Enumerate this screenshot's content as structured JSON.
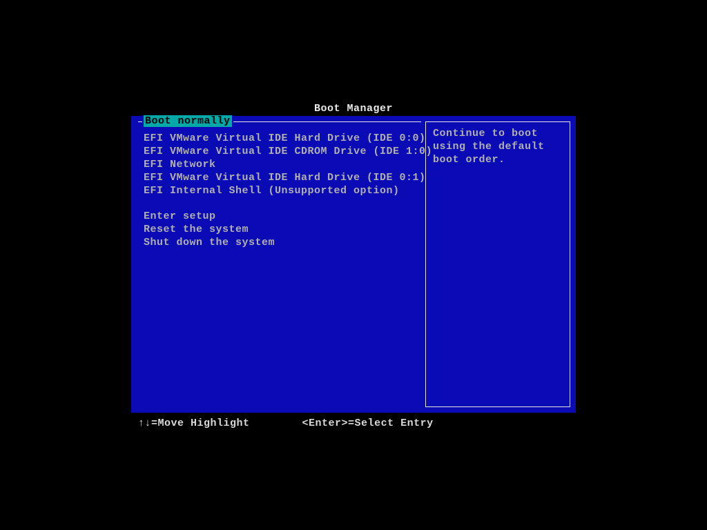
{
  "title": "Boot Manager",
  "menu": {
    "legend": "Boot normally",
    "selected_index": 0,
    "items": [
      "EFI VMware Virtual IDE Hard Drive (IDE 0:0)",
      "EFI VMware Virtual IDE CDROM Drive (IDE 1:0)",
      "EFI Network",
      "EFI VMware Virtual IDE Hard Drive (IDE 0:1)",
      "EFI Internal Shell (Unsupported option)"
    ],
    "actions": [
      "Enter setup",
      "Reset the system",
      "Shut down the system"
    ]
  },
  "info": "Continue to boot using the default boot order.",
  "footer": {
    "left": "↑↓=Move Highlight",
    "right": "<Enter>=Select Entry"
  }
}
